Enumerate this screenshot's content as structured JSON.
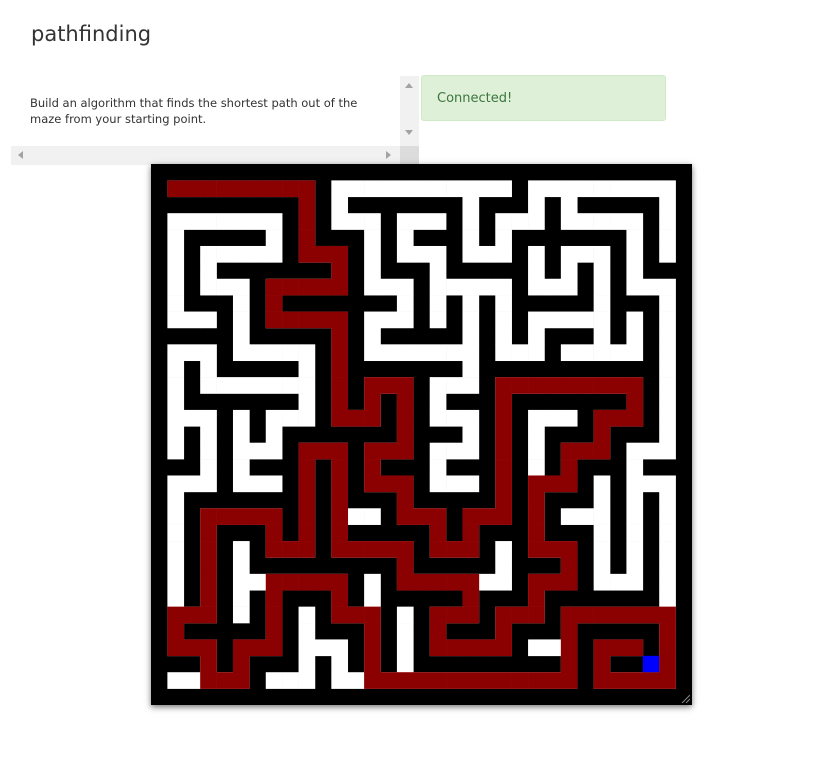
{
  "page": {
    "title": "pathfinding"
  },
  "description": {
    "text": "Build an algorithm that finds the shortest path out of the maze from your starting point."
  },
  "status": {
    "text": "Connected!",
    "color": "#3c763d",
    "background": "#dff0d8"
  },
  "maze": {
    "colors": {
      "wall": "#000000",
      "open": "#ffffff",
      "path": "#8b0000",
      "player": "#0000ff"
    },
    "rows": [
      "#################################",
      "#...............................#",
      "#...............................#",
      "#...............................#",
      "#...............................#",
      "#...............................#",
      "#...............................#",
      "#...............................#",
      "#...............................#",
      "#...............................#",
      "#...............................#",
      "#...............................#",
      "#...............................#",
      "#...............................#",
      "#...............................#",
      "#...............................#",
      "#...............................#",
      "#...............................#",
      "#...............................#",
      "#...............................#",
      "#...............................#",
      "#...............................#",
      "#...............................#",
      "#...............................#",
      "#...............................#",
      "#...............................#",
      "#...............................#",
      "#...............................#",
      "#...............................#",
      "#...............................#",
      "#...............................#",
      "#...............................#",
      "#################################"
    ]
  }
}
